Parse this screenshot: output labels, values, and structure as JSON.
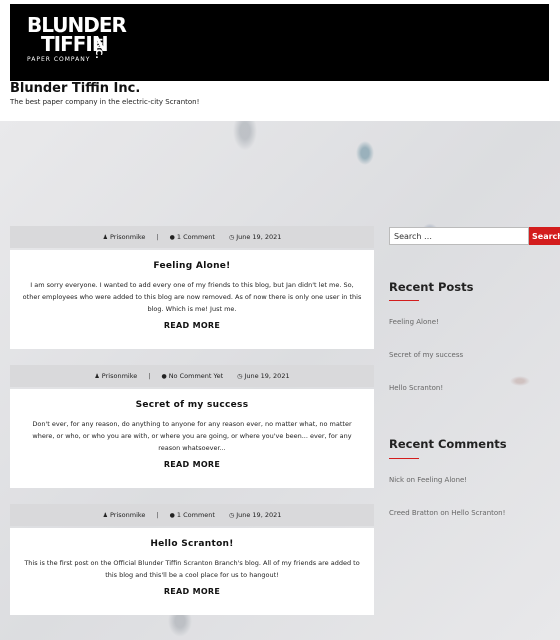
{
  "site": {
    "logo_line1": "BLUNDER",
    "logo_line2": "TIFFIN",
    "logo_inc": "INC.",
    "logo_tagline": "PAPER COMPANY",
    "title": "Blunder Tiffin Inc.",
    "description": "The best paper company in the electric-city Scranton!"
  },
  "posts": [
    {
      "author": "Prisonmike",
      "comments": "1 Comment",
      "date": "June 19, 2021",
      "title": "Feeling Alone!",
      "excerpt": "I am sorry everyone. I wanted to add every one of my friends to this blog, but Jan didn't let me. So, other employees who were added to this blog are now removed. As of now there is only one user in this blog. Which is me! Just me.",
      "read_more": "READ MORE"
    },
    {
      "author": "Prisonmike",
      "comments": "No Comment Yet",
      "date": "June 19, 2021",
      "title": "Secret of my success",
      "excerpt": "Don't ever, for any reason, do anything to anyone for any reason ever, no matter what, no matter where, or who, or who you are with, or where you are going, or where you've been... ever, for any reason whatsoever...",
      "read_more": "READ MORE"
    },
    {
      "author": "Prisonmike",
      "comments": "1 Comment",
      "date": "June 19, 2021",
      "title": "Hello Scranton!",
      "excerpt": "This is the first post on the Official Blunder Tiffin Scranton Branch's blog. All of my friends are added to this blog and this'll be a cool place for us to hangout!",
      "read_more": "READ MORE"
    }
  ],
  "sidebar": {
    "search_placeholder": "Search …",
    "search_button": "Search",
    "recent_posts_title": "Recent Posts",
    "recent_posts": [
      "Feeling Alone!",
      "Secret of my success",
      "Hello Scranton!"
    ],
    "recent_comments_title": "Recent Comments",
    "recent_comments": [
      {
        "author": "Nick",
        "on": "on",
        "post": "Feeling Alone!"
      },
      {
        "author": "Creed Bratton",
        "on": "on",
        "post": "Hello Scranton!"
      }
    ]
  },
  "colors": {
    "accent": "#d31d1d",
    "meta_bar": "#d9d9db",
    "banner": "#000000"
  },
  "icons": {
    "author": "user-icon",
    "comments": "comment-icon",
    "date": "clock-icon"
  }
}
